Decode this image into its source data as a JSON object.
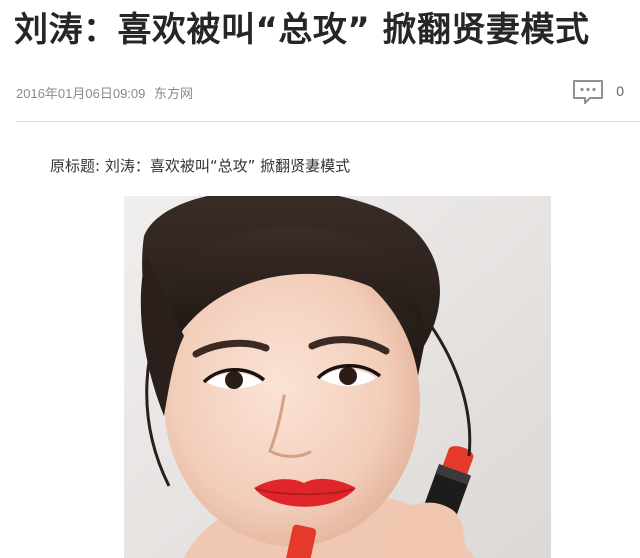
{
  "article": {
    "headline": "刘涛：喜欢被叫“总攻” 掀翻贤妻模式",
    "date": "2016年01月06日09:09",
    "source": "东方网",
    "comment_count": "0",
    "original_title": "原标题: 刘涛：喜欢被叫“总攻” 掀翻贤妻模式"
  },
  "icons": {
    "comment": "comment-bubble-icon"
  },
  "colors": {
    "headline": "#262626",
    "meta": "#8a8a8a",
    "divider": "#dcdcdc",
    "lipstick": "#e0262a"
  }
}
